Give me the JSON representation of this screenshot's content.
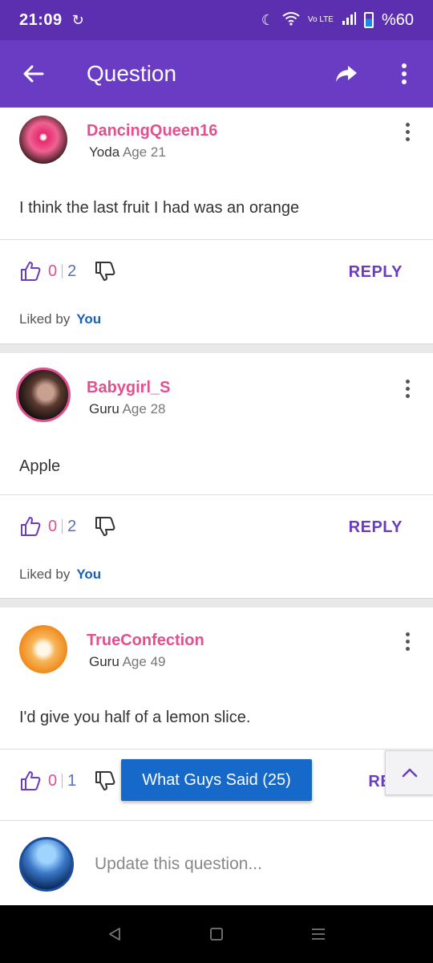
{
  "status_bar": {
    "time": "21:09",
    "network": "Vo LTE",
    "battery": "%60"
  },
  "app_bar": {
    "title": "Question",
    "back_icon": "arrow-left-icon",
    "share_icon": "share-icon",
    "menu_icon": "more-vert-icon"
  },
  "answers": [
    {
      "username": "DancingQueen16",
      "level": "Yoda",
      "age": "Age 21",
      "text": "I think the last fruit I had was an orange",
      "likes": "0",
      "total": "2",
      "reply_label": "REPLY",
      "liked_by_label": "Liked by",
      "liked_by": "You"
    },
    {
      "username": "Babygirl_S",
      "level": "Guru",
      "age": "Age 28",
      "text": "Apple",
      "likes": "0",
      "total": "2",
      "reply_label": "REPLY",
      "liked_by_label": "Liked by",
      "liked_by": "You"
    },
    {
      "username": "TrueConfection",
      "level": "Guru",
      "age": "Age 49",
      "text": "I'd give you half of a lemon slice.",
      "likes": "0",
      "total": "1",
      "reply_label": "REP"
    }
  ],
  "floating_button": {
    "label": "What Guys Said (25)"
  },
  "composer": {
    "placeholder": "Update this question..."
  },
  "colors": {
    "primary": "#6a3cc4",
    "status_bar": "#5b2fb0",
    "username": "#e2508f",
    "link": "#1a5fb4",
    "pill": "#1669c9"
  }
}
